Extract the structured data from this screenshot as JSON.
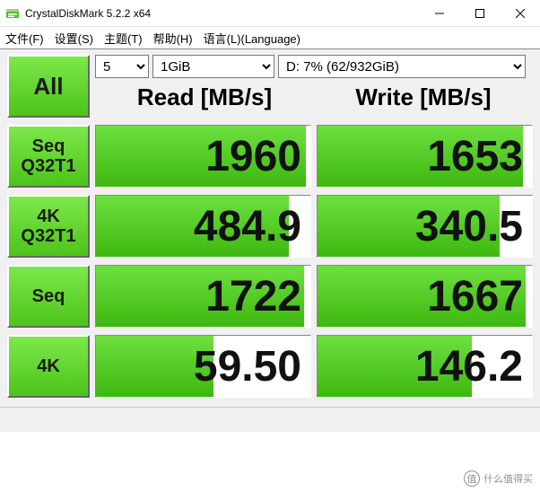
{
  "window": {
    "title": "CrystalDiskMark 5.2.2 x64"
  },
  "menu": {
    "file": "文件(F)",
    "settings": "设置(S)",
    "theme": "主题(T)",
    "help": "帮助(H)",
    "language": "语言(L)(Language)"
  },
  "controls": {
    "count": "5",
    "size": "1GiB",
    "drive": "D: 7% (62/932GiB)"
  },
  "headers": {
    "read": "Read [MB/s]",
    "write": "Write [MB/s]"
  },
  "buttons": {
    "all": "All",
    "seq_q32t1_a": "Seq",
    "seq_q32t1_b": "Q32T1",
    "r4k_q32t1_a": "4K",
    "r4k_q32t1_b": "Q32T1",
    "seq": "Seq",
    "r4k": "4K"
  },
  "results": {
    "seq_q32t1": {
      "read": "1960",
      "write": "1653"
    },
    "r4k_q32t1": {
      "read": "484.9",
      "write": "340.5"
    },
    "seq": {
      "read": "1722",
      "write": "1667"
    },
    "r4k": {
      "read": "59.50",
      "write": "146.2"
    }
  },
  "watermark": "什么值得买",
  "chart_data": {
    "type": "table",
    "title": "CrystalDiskMark 5.2.2 x64 — D: 7% (62/932GiB), 5 runs, 1GiB",
    "columns": [
      "Test",
      "Read [MB/s]",
      "Write [MB/s]"
    ],
    "rows": [
      [
        "Seq Q32T1",
        1960,
        1653
      ],
      [
        "4K Q32T1",
        484.9,
        340.5
      ],
      [
        "Seq",
        1722,
        1667
      ],
      [
        "4K",
        59.5,
        146.2
      ]
    ]
  }
}
